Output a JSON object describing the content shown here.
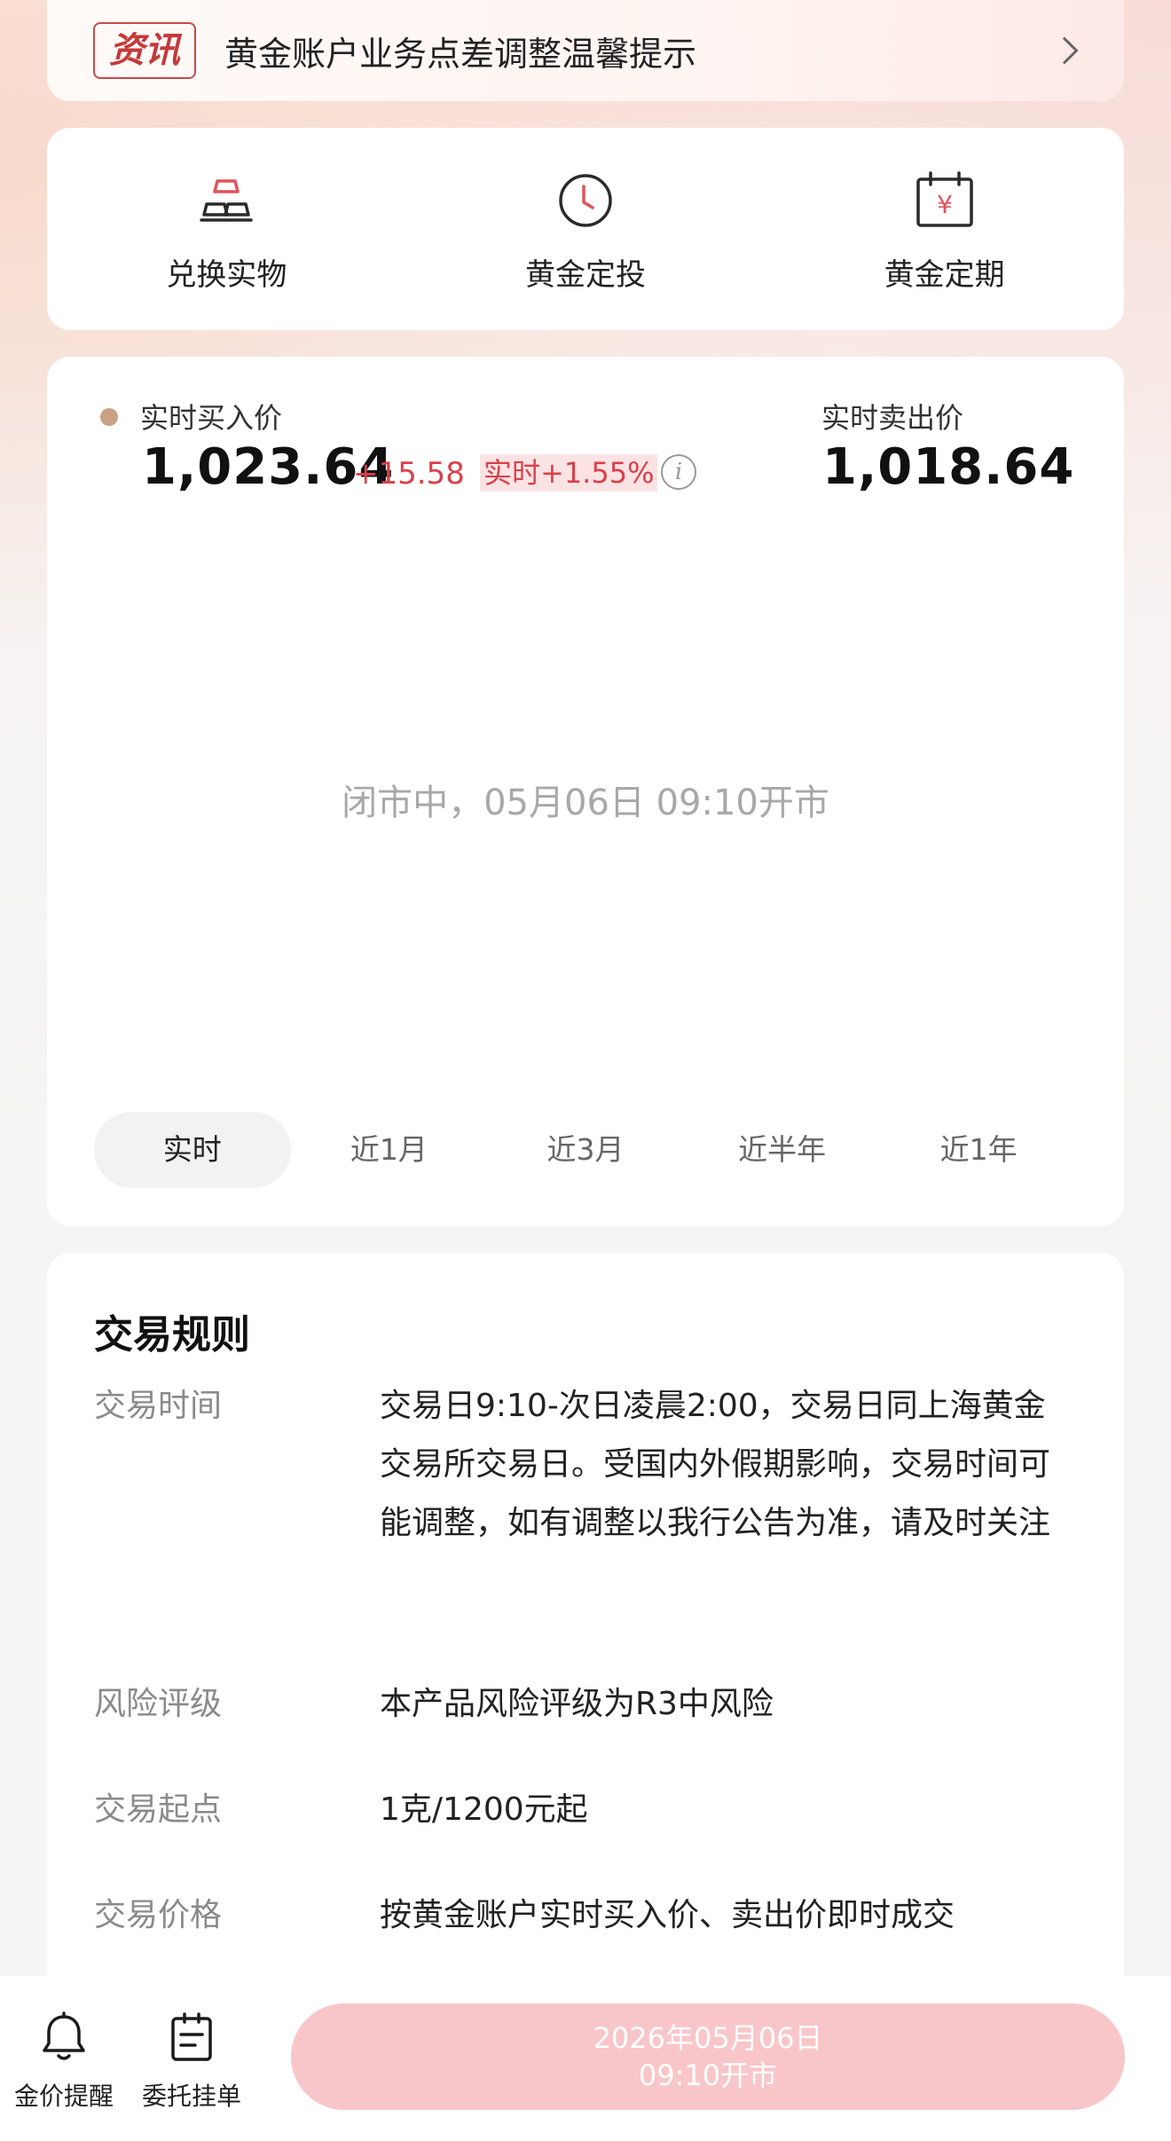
{
  "news": {
    "tag": "资讯",
    "text": "黄金账户业务点差调整温馨提示"
  },
  "actions": [
    {
      "label": "兑换实物",
      "icon": "gold-bars-icon"
    },
    {
      "label": "黄金定投",
      "icon": "clock-icon"
    },
    {
      "label": "黄金定期",
      "icon": "calendar-yen-icon"
    }
  ],
  "price": {
    "buy_label": "实时买入价",
    "buy_price": "1,023.64",
    "change": "+15.58",
    "realtime_change": "实时+1.55%",
    "sell_label": "实时卖出价",
    "sell_price": "1,018.64",
    "closed_message": "闭市中，05月06日 09:10开市",
    "ranges": [
      "实时",
      "近1月",
      "近3月",
      "近半年",
      "近1年"
    ],
    "active_range": "实时"
  },
  "rules": {
    "title": "交易规则",
    "items": [
      {
        "key": "交易时间",
        "value": "交易日9:10-次日凌晨2:00，交易日同上海黄金交易所交易日。受国内外假期影响，交易时间可能调整，如有调整以我行公告为准，请及时关注"
      },
      {
        "key": "风险评级",
        "value": "本产品风险评级为R3中风险"
      },
      {
        "key": "交易起点",
        "value": "1克/1200元起"
      },
      {
        "key": "交易价格",
        "value": "按黄金账户实时买入价、卖出价即时成交"
      }
    ]
  },
  "bottom": {
    "alert_label": "金价提醒",
    "orders_label": "委托挂单",
    "cta_line1": "2026年05月06日",
    "cta_line2": "09:10开市"
  },
  "colors": {
    "accent_red": "#d9404a",
    "cta_disabled": "#f8c6c9"
  }
}
